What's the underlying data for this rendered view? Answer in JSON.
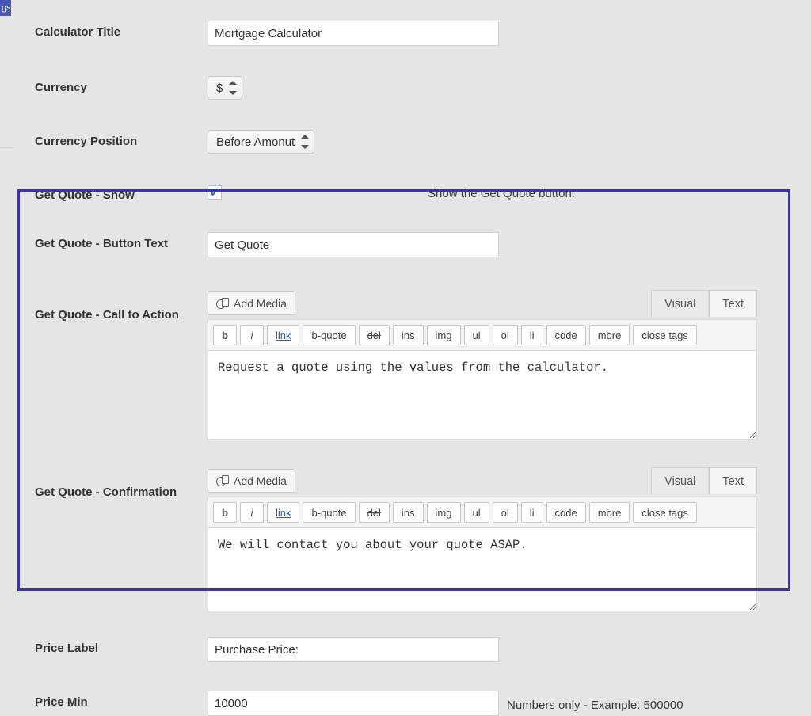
{
  "side_tab": "gs",
  "labels": {
    "calculator_title": "Calculator Title",
    "currency": "Currency",
    "currency_position": "Currency Position",
    "get_quote_show": "Get Quote - Show",
    "get_quote_button_text": "Get Quote - Button Text",
    "get_quote_cta": "Get Quote - Call to Action",
    "get_quote_confirmation": "Get Quote - Confirmation",
    "price_label": "Price Label",
    "price_min": "Price Min"
  },
  "values": {
    "calculator_title": "Mortgage Calculator",
    "currency": "$",
    "currency_position": "Before Amonut",
    "get_quote_show_checked": true,
    "get_quote_button_text": "Get Quote",
    "cta_text": "Request a quote using the values from the calculator.",
    "confirmation_text": "We will contact you about your quote ASAP.",
    "price_label": "Purchase Price:",
    "price_min": "10000"
  },
  "descriptions": {
    "get_quote_show": "Show the Get Quote button.",
    "price_min": "Numbers only - Example: 500000"
  },
  "editor": {
    "add_media": "Add Media",
    "tabs": {
      "visual": "Visual",
      "text": "Text"
    },
    "quicktags": {
      "b": "b",
      "i": "i",
      "link": "link",
      "bquote": "b-quote",
      "del": "del",
      "ins": "ins",
      "img": "img",
      "ul": "ul",
      "ol": "ol",
      "li": "li",
      "code": "code",
      "more": "more",
      "close": "close tags"
    }
  }
}
